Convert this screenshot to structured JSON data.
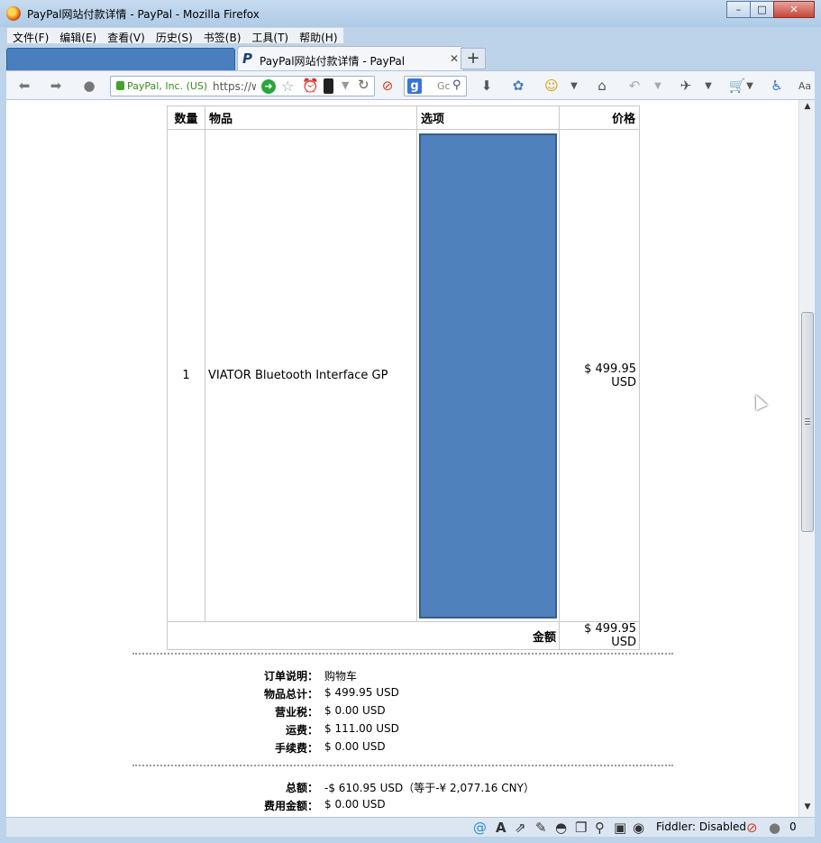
{
  "window": {
    "title": "PayPal网站付款详情 - PayPal - Mozilla Firefox",
    "minimize": "–",
    "maximize": "□",
    "close": "✕"
  },
  "menubar": {
    "items": [
      "文件(F)",
      "编辑(E)",
      "查看(V)",
      "历史(S)",
      "书签(B)",
      "工具(T)",
      "帮助(H)"
    ]
  },
  "tabs": {
    "active_title": "PayPal网站付款详情 - PayPal",
    "close": "✕",
    "new_tab": "+"
  },
  "navbar": {
    "identity": "PayPal, Inc. (US)",
    "url": "https://w",
    "search_engine": "g",
    "search_placeholder": "Gc"
  },
  "order_table": {
    "headers": {
      "qty": "数量",
      "item": "物品",
      "options": "选项",
      "price": "价格"
    },
    "rows": [
      {
        "qty": "1",
        "item": "VIATOR Bluetooth Interface GP",
        "price": "$ 499.95 USD"
      }
    ],
    "total_label": "金额",
    "total_value": "$ 499.95 USD"
  },
  "summary": {
    "order_desc_label": "订单说明：",
    "order_desc_value": "购物车",
    "items_total_label": "物品总计：",
    "items_total_value": "$ 499.95 USD",
    "tax_label": "营业税：",
    "tax_value": "$ 0.00 USD",
    "shipping_label": "运费：",
    "shipping_value": "$ 111.00 USD",
    "fee_label": "手续费：",
    "fee_value": "$ 0.00 USD",
    "total_label": "总额：",
    "total_value": "-$ 610.95 USD（等于-¥ 2,077.16 CNY）",
    "fee_amount_label": "费用金额：",
    "fee_amount_value": "$ 0.00 USD"
  },
  "statusbar": {
    "fiddler": "Fiddler: Disabled",
    "count": "0"
  },
  "colors": {
    "options_block": "#4f81bd",
    "identity_green": "#3a8a1d"
  }
}
